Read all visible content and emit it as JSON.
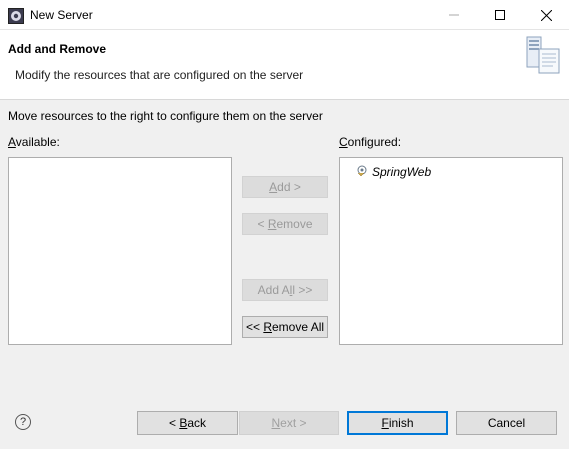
{
  "window": {
    "title": "New Server"
  },
  "header": {
    "title": "Add and Remove",
    "description": "Modify the resources that are configured on the server"
  },
  "instructions": "Move resources to the right to configure them on the server",
  "available": {
    "label_first": "A",
    "label_rest": "vailable:",
    "items": []
  },
  "configured": {
    "label_first": "C",
    "label_rest": "onfigured:",
    "items": [
      {
        "label": "SpringWeb",
        "icon": "web-module-icon"
      }
    ]
  },
  "buttons": {
    "add": {
      "pre": "",
      "acc": "A",
      "post": "dd >",
      "enabled": false
    },
    "remove": {
      "pre": "< ",
      "acc": "R",
      "post": "emove",
      "enabled": false
    },
    "add_all": {
      "pre": "Add A",
      "acc": "l",
      "post": "l >>",
      "enabled": false
    },
    "remove_all": {
      "pre": "<< ",
      "acc": "R",
      "post": "emove All",
      "enabled": true
    }
  },
  "footer": {
    "back": {
      "pre": "< ",
      "acc": "B",
      "post": "ack",
      "enabled": true
    },
    "next": {
      "pre": "",
      "acc": "N",
      "post": "ext >",
      "enabled": false
    },
    "finish": {
      "pre": "",
      "acc": "F",
      "post": "inish",
      "enabled": true,
      "default": true
    },
    "cancel": {
      "label": "Cancel",
      "enabled": true
    }
  },
  "colors": {
    "accent": "#0078d7",
    "header_bg": "#ffffff",
    "dialog_bg": "#f0f0f0"
  }
}
